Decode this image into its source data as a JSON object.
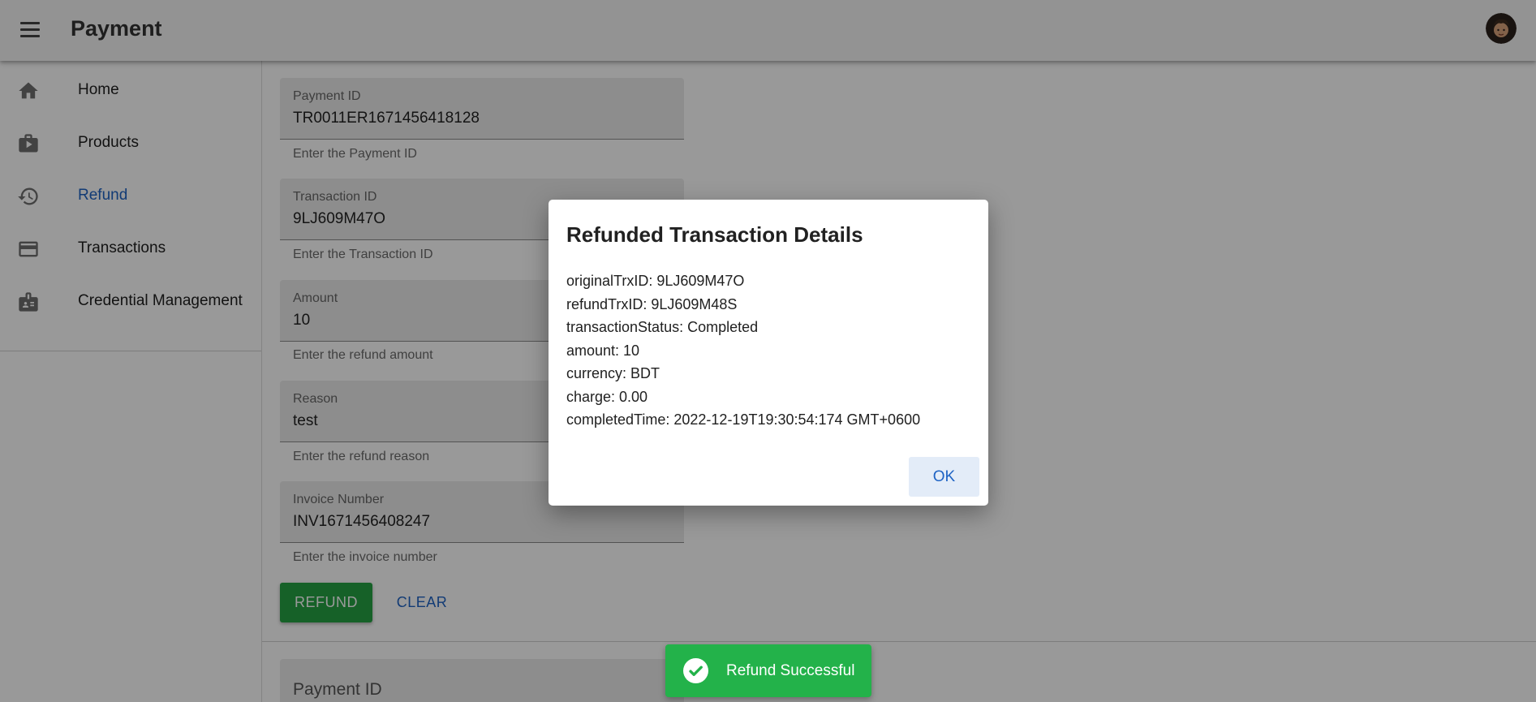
{
  "app": {
    "title": "Payment"
  },
  "colors": {
    "accent": "#1e63c4",
    "refund_button": "#25a244",
    "snackbar": "#23b24a"
  },
  "sidebar": {
    "items": [
      {
        "label": "Home",
        "icon": "home-icon"
      },
      {
        "label": "Products",
        "icon": "products-icon"
      },
      {
        "label": "Refund",
        "icon": "history-icon",
        "active": true
      },
      {
        "label": "Transactions",
        "icon": "credit-card-icon"
      },
      {
        "label": "Credential Management",
        "icon": "badge-icon"
      }
    ]
  },
  "form": {
    "payment_id": {
      "label": "Payment ID",
      "value": "TR0011ER1671456418128",
      "helper": "Enter the Payment ID"
    },
    "transaction_id": {
      "label": "Transaction ID",
      "value": "9LJ609M47O",
      "helper": "Enter the Transaction ID"
    },
    "amount": {
      "label": "Amount",
      "value": "10",
      "helper": "Enter the refund amount"
    },
    "reason": {
      "label": "Reason",
      "value": "test",
      "helper": "Enter the refund reason"
    },
    "invoice_number": {
      "label": "Invoice Number",
      "value": "INV1671456408247",
      "helper": "Enter the invoice number"
    },
    "refund_label": "REFUND",
    "clear_label": "CLEAR"
  },
  "second_form": {
    "payment_id_label": "Payment ID"
  },
  "dialog": {
    "title": "Refunded Transaction Details",
    "lines": [
      "originalTrxID: 9LJ609M47O",
      "refundTrxID: 9LJ609M48S",
      "transactionStatus: Completed",
      "amount: 10",
      "currency: BDT",
      "charge: 0.00",
      "completedTime: 2022-12-19T19:30:54:174 GMT+0600"
    ],
    "ok_label": "OK"
  },
  "snackbar": {
    "message": "Refund Successful",
    "icon": "check-circle-icon"
  }
}
